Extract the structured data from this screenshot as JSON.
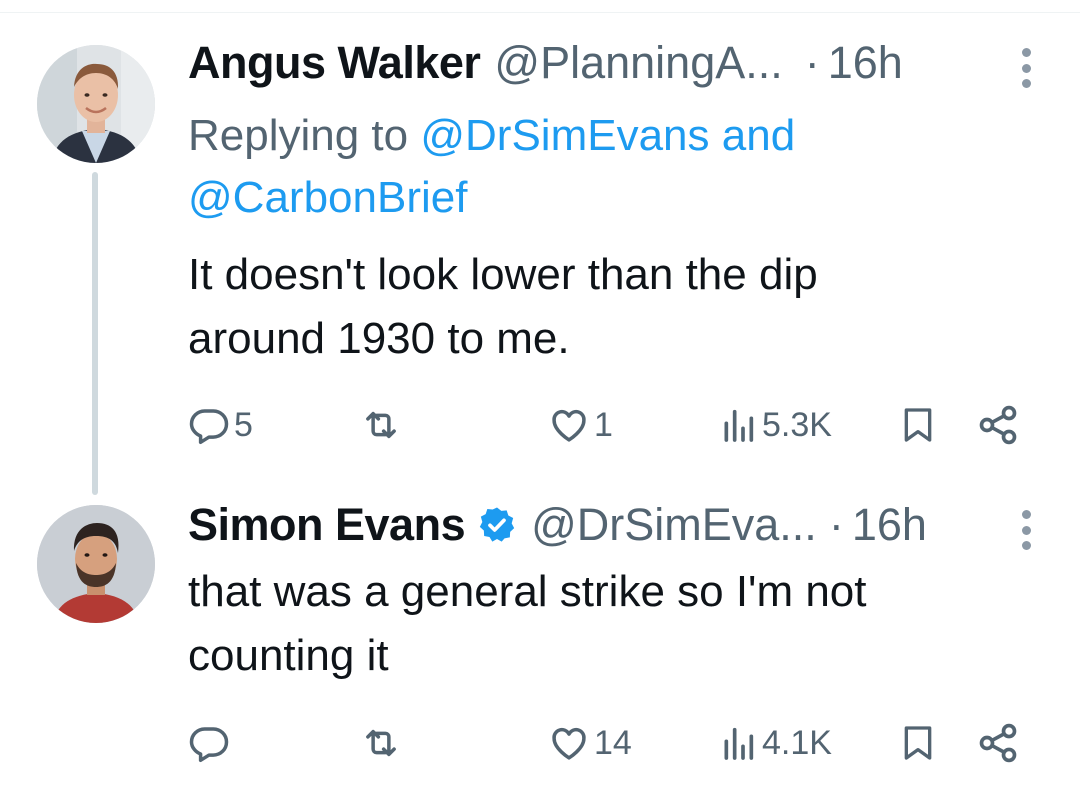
{
  "tweets": [
    {
      "name": "Angus Walker",
      "handle": "@PlanningA...",
      "separator": "·",
      "time": "16h",
      "verified": false,
      "replying_prefix": "Replying to ",
      "replying_mention_1": "@DrSimEvans",
      "replying_and": " and",
      "replying_mention_2": "@CarbonBrief",
      "text_line_1": "It doesn't look lower than the dip",
      "text_line_2": "around 1930 to me.",
      "stats": {
        "replies": "5",
        "reposts": "",
        "likes": "1",
        "views": "5.3K"
      }
    },
    {
      "name": "Simon Evans",
      "handle": "@DrSimEva...",
      "separator": "·",
      "time": "16h",
      "verified": true,
      "text_line_1": "that was a general strike so I'm not",
      "text_line_2": "counting it",
      "stats": {
        "replies": "",
        "reposts": "",
        "likes": "14",
        "views": "4.1K"
      }
    }
  ],
  "icons": {
    "reply": "reply-icon",
    "repost": "repost-icon",
    "like": "heart-icon",
    "views": "views-icon",
    "bookmark": "bookmark-icon",
    "share": "share-icon",
    "more": "more-vertical-icon",
    "verified": "verified-badge-icon"
  },
  "colors": {
    "text": "#0f1419",
    "secondary": "#536471",
    "accent": "#1d9bf0",
    "thread_line": "#cfd9de"
  }
}
